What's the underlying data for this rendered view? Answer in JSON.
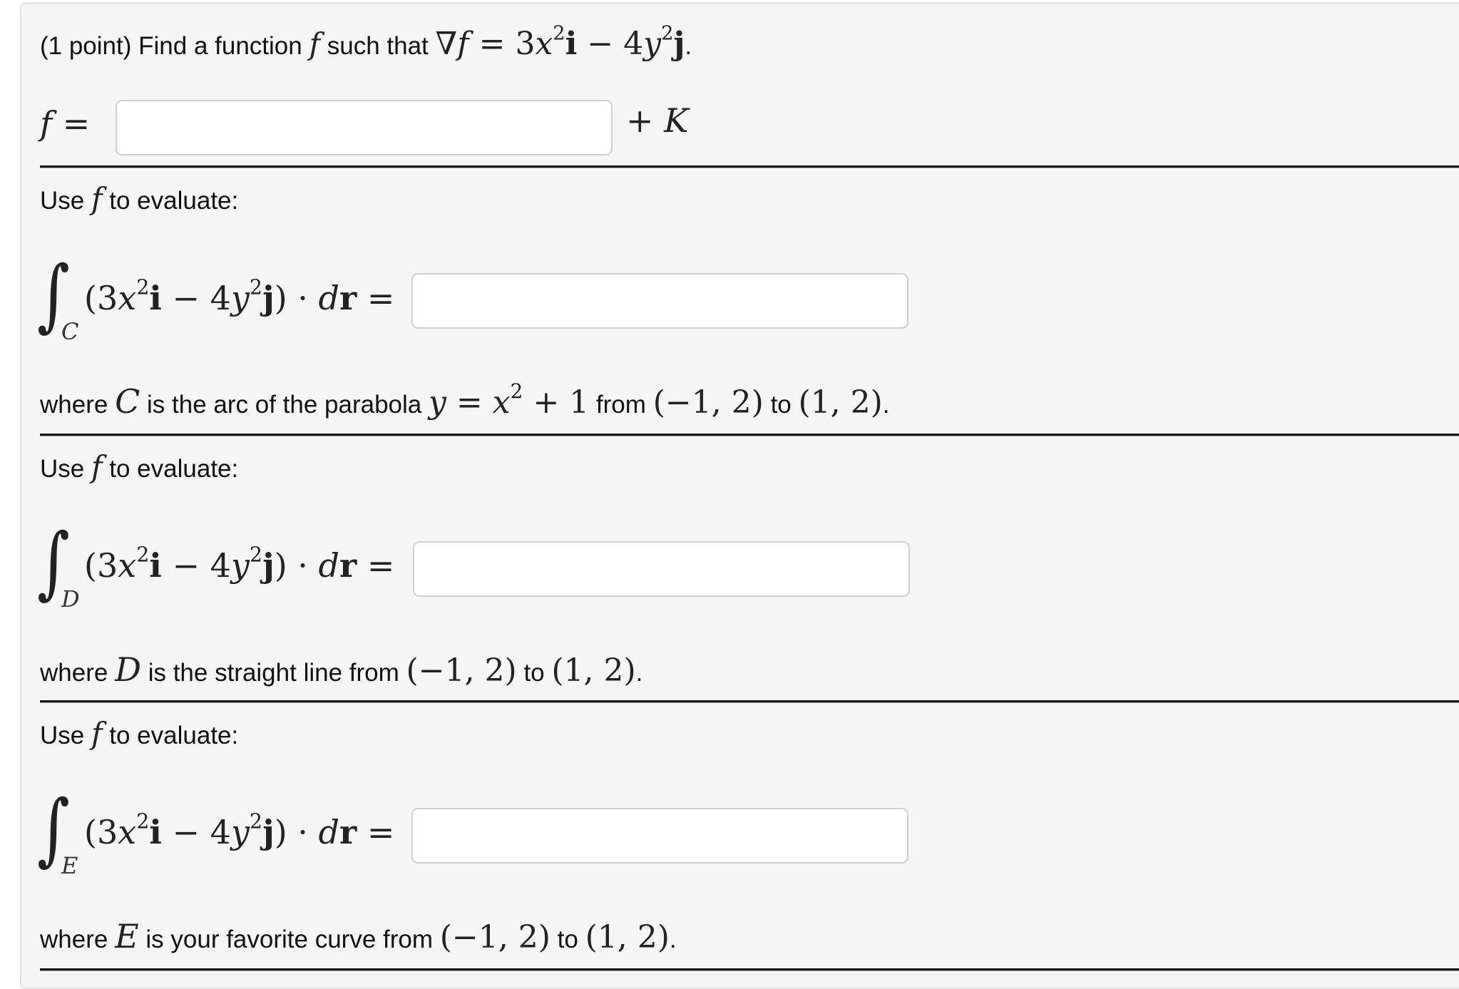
{
  "problem": {
    "points_label": "(1 point)",
    "intro_text_1": "Find a function",
    "intro_var": "f",
    "intro_text_2": "such that",
    "gradient_symbol": "∇",
    "gradient_var": "f",
    "equals": "=",
    "coef_x": "3",
    "var_x": "x",
    "exp": "2",
    "unit_i": "i",
    "minus": "−",
    "coef_y": "4",
    "var_y": "y",
    "unit_j": "j",
    "period": "."
  },
  "potential": {
    "label_var": "f",
    "equals": "=",
    "input_value": "",
    "suffix_plus": "+",
    "suffix_const": "K"
  },
  "evaluate_label": {
    "text_1": "Use",
    "var": "f",
    "text_2": "to evaluate:"
  },
  "integral": {
    "sign": "∫",
    "open_paren": "(",
    "close_paren": ")",
    "dot": "·",
    "d": "d",
    "r": "r",
    "equals": "="
  },
  "parts": [
    {
      "curve": "C",
      "input_value": "",
      "desc_prefix": "where",
      "desc_text": "is the arc of the parabola",
      "curve_eq": "y = x² + 1",
      "from_word": "from",
      "start_point": "(−1, 2)",
      "to_word": "to",
      "end_point": "(1, 2)",
      "end": "."
    },
    {
      "curve": "D",
      "input_value": "",
      "desc_prefix": "where",
      "desc_text": "is the straight line",
      "curve_eq": "",
      "from_word": "from",
      "start_point": "(−1, 2)",
      "to_word": "to",
      "end_point": "(1, 2)",
      "end": "."
    },
    {
      "curve": "E",
      "input_value": "",
      "desc_prefix": "where",
      "desc_text": "is your favorite curve",
      "curve_eq": "",
      "from_word": "from",
      "start_point": "(−1, 2)",
      "to_word": "to",
      "end_point": "(1, 2)",
      "end": "."
    }
  ],
  "colors": {
    "panel_bg": "#f5f5f5",
    "panel_border": "#e3e3e3",
    "input_border": "#cfcfcf",
    "rule": "#1a1a1a"
  }
}
